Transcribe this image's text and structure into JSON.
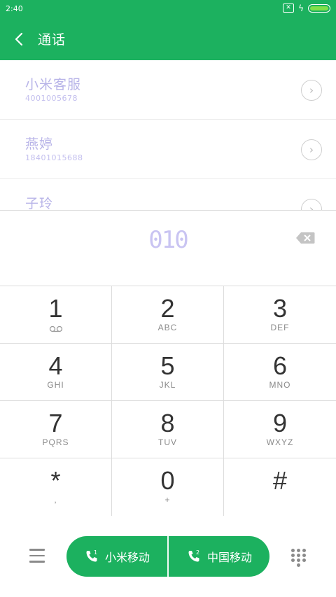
{
  "status": {
    "time": "2:40",
    "battery_color": "#7fe04a"
  },
  "header": {
    "title": "通话",
    "back_icon": "chevron-left-icon",
    "color": "#1cb15f"
  },
  "suggestions": [
    {
      "name": "小米客服",
      "number": "4001005678"
    },
    {
      "name": "燕婷",
      "number": "18401015688"
    },
    {
      "name": "子玲",
      "number": ""
    }
  ],
  "dialer": {
    "dialed": "010"
  },
  "keypad": [
    {
      "digit": "1",
      "letters": ""
    },
    {
      "digit": "2",
      "letters": "ABC"
    },
    {
      "digit": "3",
      "letters": "DEF"
    },
    {
      "digit": "4",
      "letters": "GHI"
    },
    {
      "digit": "5",
      "letters": "JKL"
    },
    {
      "digit": "6",
      "letters": "MNO"
    },
    {
      "digit": "7",
      "letters": "PQRS"
    },
    {
      "digit": "8",
      "letters": "TUV"
    },
    {
      "digit": "9",
      "letters": "WXYZ"
    },
    {
      "digit": "*",
      "letters": ","
    },
    {
      "digit": "0",
      "letters": "+"
    },
    {
      "digit": "#",
      "letters": ""
    }
  ],
  "bottom": {
    "sim1_label": "小米移动",
    "sim2_label": "中国移动",
    "sim1_badge": "1",
    "sim2_badge": "2"
  }
}
